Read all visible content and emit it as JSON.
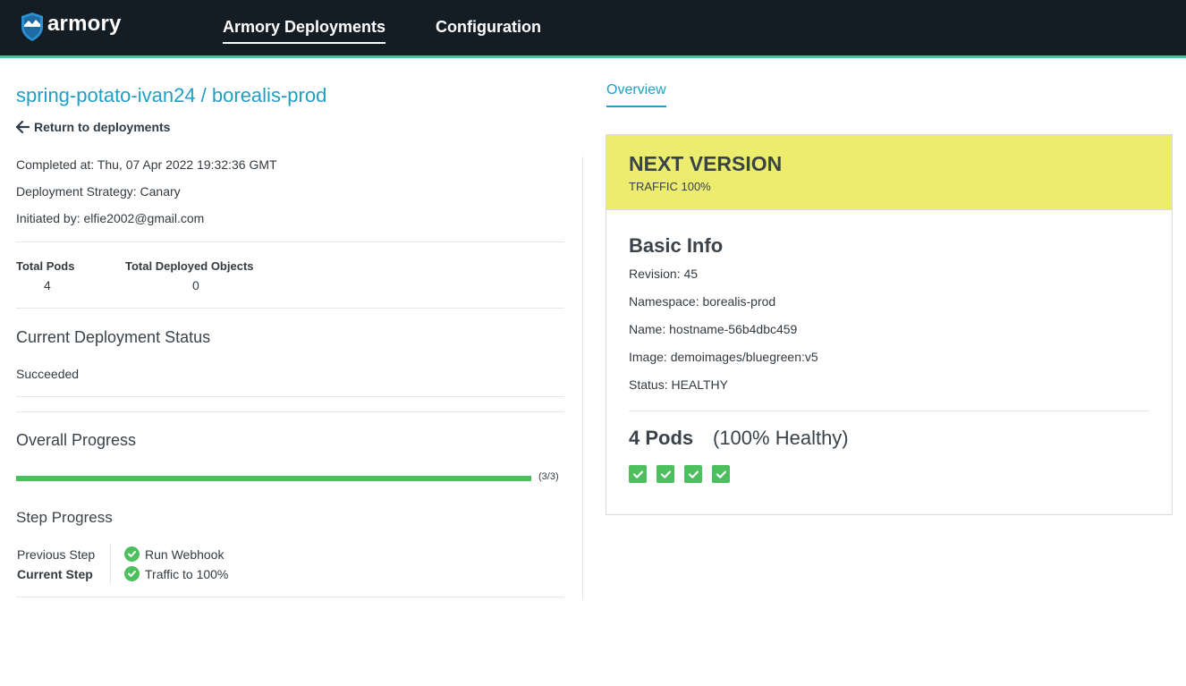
{
  "app": {
    "brand": "armory",
    "nav": [
      {
        "label": "Armory Deployments",
        "active": true
      },
      {
        "label": "Configuration",
        "active": false
      }
    ],
    "accent_color": "#4dbf94",
    "topbar_color": "#141d24"
  },
  "deployment": {
    "title": "spring-potato-ivan24 / borealis-prod",
    "back_label": "Return to deployments",
    "completed_at": "Completed at: Thu, 07 Apr 2022 19:32:36 GMT",
    "strategy": "Deployment Strategy: Canary",
    "initiated_by": "Initiated by: elfie2002@gmail.com",
    "stats": {
      "total_pods_label": "Total Pods",
      "total_pods_value": "4",
      "total_objects_label": "Total Deployed Objects",
      "total_objects_value": "0"
    },
    "status_title": "Current Deployment Status",
    "status_value": "Succeeded",
    "progress_title": "Overall Progress",
    "progress_fraction": 1.0,
    "progress_count": "(3/3)",
    "step_title": "Step Progress",
    "steps": [
      {
        "label": "Previous Step",
        "value": "Run Webhook",
        "bold": false
      },
      {
        "label": "Current Step",
        "value": "Traffic to 100%",
        "bold": true
      }
    ],
    "success_color": "#4dbf5f"
  },
  "overview": {
    "tab_label": "Overview",
    "version_title": "NEXT VERSION",
    "version_traffic": "TRAFFIC 100%",
    "header_color": "#ecec6e",
    "basic_info_title": "Basic Info",
    "info": {
      "revision": "Revision: 45",
      "namespace": "Namespace: borealis-prod",
      "name": "Name: hostname-56b4dbc459",
      "image": "Image: demoimages/bluegreen:v5",
      "status": "Status: HEALTHY"
    },
    "pods_title": "4 Pods",
    "pods_health": "(100% Healthy)",
    "pods_count": 4
  }
}
